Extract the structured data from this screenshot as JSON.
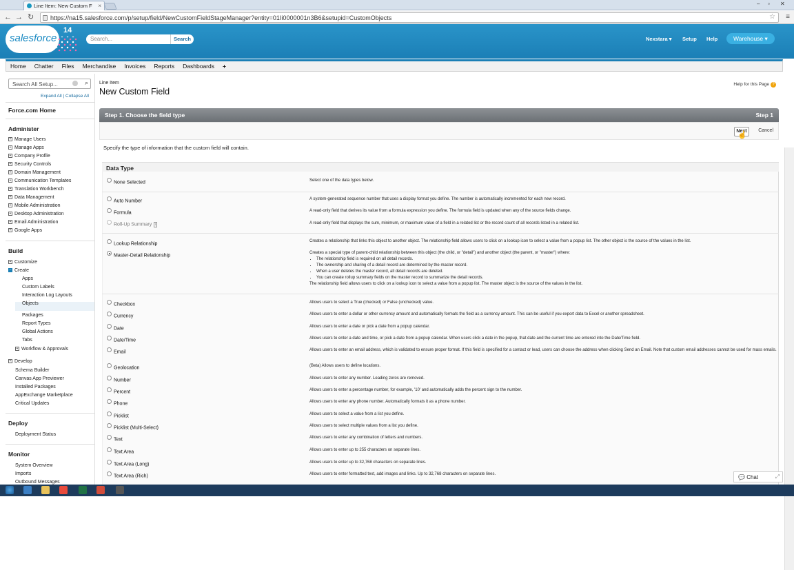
{
  "browser": {
    "tab_title": "Line Item: New Custom F",
    "url": "https://na15.salesforce.com/p/setup/field/NewCustomFieldStageManager?entity=01Ii0000001n3B6&setupid=CustomObjects"
  },
  "header": {
    "logo": "salesforce",
    "version": "14",
    "search_placeholder": "Search...",
    "search_button": "Search",
    "user_menu": "Nexstara",
    "setup": "Setup",
    "help": "Help",
    "app_menu": "Warehouse"
  },
  "tabs": [
    "Home",
    "Chatter",
    "Files",
    "Merchandise",
    "Invoices",
    "Reports",
    "Dashboards",
    "+"
  ],
  "sidebar": {
    "search_placeholder": "Search All Setup...",
    "expand_collapse": "Expand All | Collapse All",
    "home": "Force.com Home",
    "administer_title": "Administer",
    "administer_items": [
      "Manage Users",
      "Manage Apps",
      "Company Profile",
      "Security Controls",
      "Domain Management",
      "Communication Templates",
      "Translation Workbench",
      "Data Management",
      "Mobile Administration",
      "Desktop Administration",
      "Email Administration",
      "Google Apps"
    ],
    "build_title": "Build",
    "build_customize": "Customize",
    "build_create": "Create",
    "create_children": [
      "Apps",
      "Custom Labels",
      "Interaction Log Layouts",
      "Objects",
      "Packages",
      "Report Types",
      "Global Actions",
      "Tabs"
    ],
    "workflow": "Workflow & Approvals",
    "develop": "Develop",
    "build_more": [
      "Schema Builder",
      "Canvas App Previewer",
      "Installed Packages",
      "AppExchange Marketplace",
      "Critical Updates"
    ],
    "deploy_title": "Deploy",
    "deploy_items": [
      "Deployment Status"
    ],
    "monitor_title": "Monitor",
    "monitor_items": [
      "System Overview",
      "Imports",
      "Outbound Messages"
    ]
  },
  "main": {
    "breadcrumb": "Line Item",
    "title": "New Custom Field",
    "help_link": "Help for this Page",
    "step_title": "Step 1. Choose the field type",
    "step_right": "Step 1",
    "next": "Next",
    "cancel": "Cancel",
    "intro": "Specify the type of information that the custom field will contain.",
    "data_type_heading": "Data Type",
    "none_selected": "None Selected",
    "none_desc": "Select one of the data types below.",
    "auto_number": "Auto Number",
    "auto_number_desc": "A system-generated sequence number that uses a display format you define. The number is automatically incremented for each new record.",
    "formula": "Formula",
    "formula_desc": "A read-only field that derives its value from a formula expression you define. The formula field is updated when any of the source fields change.",
    "rollup": "Roll-Up Summary",
    "rollup_info": "i",
    "rollup_desc": "A read-only field that displays the sum, minimum, or maximum value of a field in a related list or the record count of all records listed in a related list.",
    "lookup": "Lookup Relationship",
    "lookup_desc": "Creates a relationship that links this object to another object. The relationship field allows users to click on a lookup icon to select a value from a popup list. The other object is the source of the values in the list.",
    "master": "Master-Detail Relationship",
    "master_desc_intro": "Creates a special type of parent-child relationship between this object (the child, or \"detail\") and another object (the parent, or \"master\") where:",
    "master_bullets": [
      "The relationship field is required on all detail records.",
      "The ownership and sharing of a detail record are determined by the master record.",
      "When a user deletes the master record, all detail records are deleted.",
      "You can create rollup summary fields on the master record to summarize the detail records."
    ],
    "master_desc_end": "The relationship field allows users to click on a lookup icon to select a value from a popup list. The master object is the source of the values in the list.",
    "simple_types": [
      {
        "label": "Checkbox",
        "desc": "Allows users to select a True (checked) or False (unchecked) value."
      },
      {
        "label": "Currency",
        "desc": "Allows users to enter a dollar or other currency amount and automatically formats the field as a currency amount. This can be useful if you export data to Excel or another spreadsheet."
      },
      {
        "label": "Date",
        "desc": "Allows users to enter a date or pick a date from a popup calendar."
      },
      {
        "label": "Date/Time",
        "desc": "Allows users to enter a date and time, or pick a date from a popup calendar. When users click a date in the popup, that date and the current time are entered into the Date/Time field."
      },
      {
        "label": "Email",
        "desc": "Allows users to enter an email address, which is validated to ensure proper format. If this field is specified for a contact or lead, users can choose the address when clicking Send an Email. Note that custom email addresses cannot be used for mass emails."
      },
      {
        "label": "Geolocation",
        "desc": "(Beta) Allows users to define locations."
      },
      {
        "label": "Number",
        "desc": "Allows users to enter any number. Leading zeros are removed."
      },
      {
        "label": "Percent",
        "desc": "Allows users to enter a percentage number, for example, '10' and automatically adds the percent sign to the number."
      },
      {
        "label": "Phone",
        "desc": "Allows users to enter any phone number. Automatically formats it as a phone number."
      },
      {
        "label": "Picklist",
        "desc": "Allows users to select a value from a list you define."
      },
      {
        "label": "Picklist (Multi-Select)",
        "desc": "Allows users to select multiple values from a list you define."
      },
      {
        "label": "Text",
        "desc": "Allows users to enter any combination of letters and numbers."
      },
      {
        "label": "Text Area",
        "desc": "Allows users to enter up to 255 characters on separate lines."
      },
      {
        "label": "Text Area (Long)",
        "desc": "Allows users to enter up to 32,768 characters on separate lines."
      },
      {
        "label": "Text Area (Rich)",
        "desc": "Allows users to enter formatted text, add images and links. Up to 32,768 characters on separate lines."
      }
    ]
  },
  "chat": "Chat",
  "colors": {
    "header": "#1b7fb6",
    "accent": "#3ab0e2",
    "step_header": "#6b7075"
  }
}
